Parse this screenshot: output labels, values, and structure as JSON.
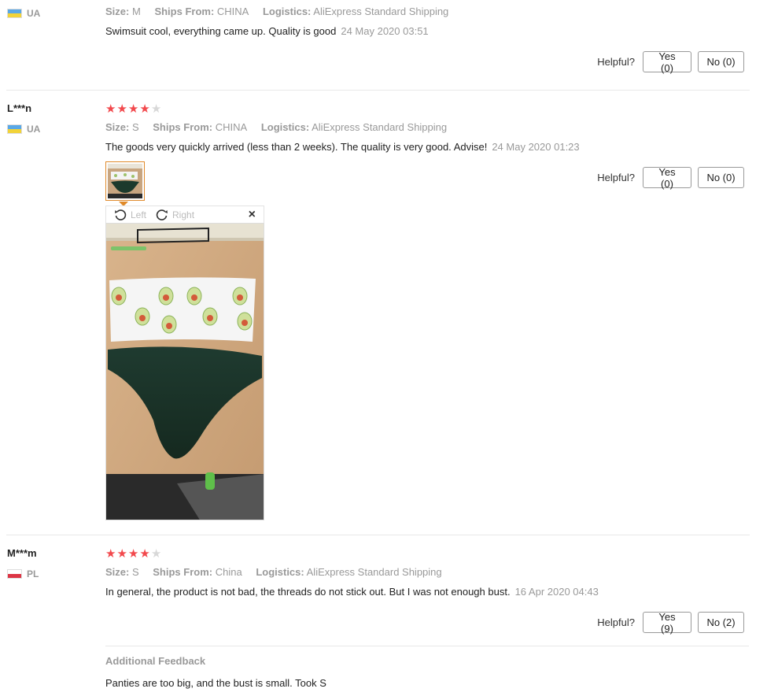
{
  "reviews": [
    {
      "user": "",
      "country": "UA",
      "flag": "ua",
      "rating": 0,
      "size_label": "Size:",
      "size": "M",
      "ships_label": "Ships From:",
      "ships": "CHINA",
      "logistics_label": "Logistics:",
      "logistics": "AliExpress Standard Shipping",
      "text": "Swimsuit cool, everything came up. Quality is good",
      "date": "24 May 2020 03:51",
      "helpful_label": "Helpful?",
      "yes": "Yes (0)",
      "no": "No (0)"
    },
    {
      "user": "L***n",
      "country": "UA",
      "flag": "ua",
      "rating": 4,
      "size_label": "Size:",
      "size": "S",
      "ships_label": "Ships From:",
      "ships": "CHINA",
      "logistics_label": "Logistics:",
      "logistics": "AliExpress Standard Shipping",
      "text": "The goods very quickly arrived (less than 2 weeks). The quality is very good. Advise!",
      "date": "24 May 2020 01:23",
      "helpful_label": "Helpful?",
      "yes": "Yes (0)",
      "no": "No (0)",
      "viewer": {
        "left_label": "Left",
        "right_label": "Right",
        "close": "×"
      }
    },
    {
      "user": "M***m",
      "country": "PL",
      "flag": "pl",
      "rating": 4,
      "size_label": "Size:",
      "size": "S",
      "ships_label": "Ships From:",
      "ships": "China",
      "logistics_label": "Logistics:",
      "logistics": "AliExpress Standard Shipping",
      "text": "In general, the product is not bad, the threads do not stick out. But I was not enough bust.",
      "date": "16 Apr 2020 04:43",
      "helpful_label": "Helpful?",
      "yes": "Yes (9)",
      "no": "No (2)",
      "additional_title": "Additional Feedback",
      "additional_text": "Panties are too big, and the bust is small. Took S"
    }
  ],
  "colors": {
    "star": "#f2494d",
    "star_off": "#d8d8d8",
    "thumb_border": "#e08a2a"
  },
  "icons": [
    "rotate-left-icon",
    "rotate-right-icon",
    "close-icon",
    "star-icon",
    "flag-icon"
  ]
}
